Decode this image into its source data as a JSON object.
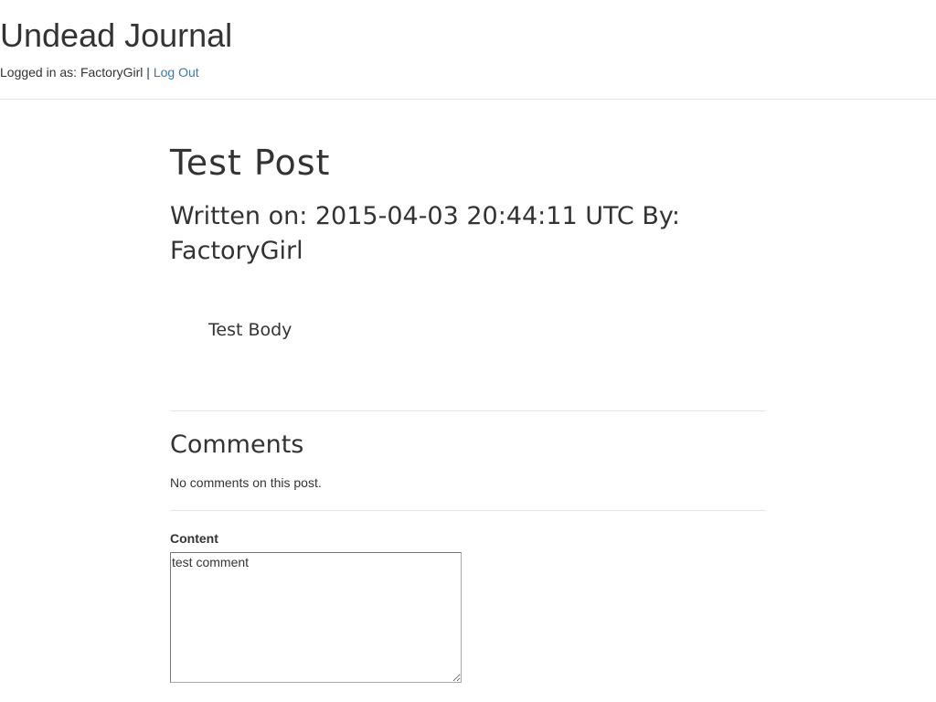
{
  "header": {
    "site_title": "Undead Journal",
    "logged_in_prefix": "Logged in as: FactoryGirl",
    "separator": " | ",
    "logout_label": "Log Out",
    "link_color": "#337ab7"
  },
  "post": {
    "title": "Test Post",
    "meta": "Written on: 2015-04-03 20:44:11 UTC By: FactoryGirl",
    "body": "Test Body"
  },
  "comments": {
    "heading": "Comments",
    "empty_text": "No comments on this post."
  },
  "comment_form": {
    "content_label": "Content",
    "content_value": "test comment"
  }
}
